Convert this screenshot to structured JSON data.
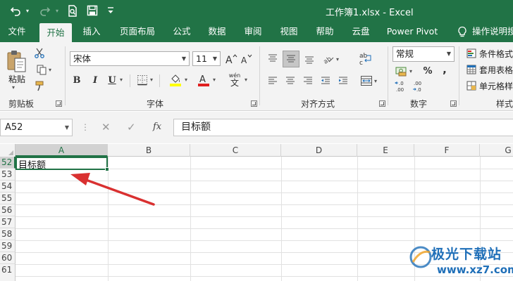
{
  "window": {
    "title": "工作簿1.xlsx  -  Excel"
  },
  "quick_access": [
    "undo-icon",
    "redo-icon",
    "print-preview-icon",
    "save-icon",
    "customize-qat-icon"
  ],
  "tabs": [
    {
      "label": "文件"
    },
    {
      "label": "开始",
      "active": true
    },
    {
      "label": "插入"
    },
    {
      "label": "页面布局"
    },
    {
      "label": "公式"
    },
    {
      "label": "数据"
    },
    {
      "label": "审阅"
    },
    {
      "label": "视图"
    },
    {
      "label": "帮助"
    },
    {
      "label": "云盘"
    },
    {
      "label": "Power Pivot"
    },
    {
      "label": "操作说明搜"
    }
  ],
  "ribbon": {
    "clipboard": {
      "label": "剪贴板",
      "paste_label": "粘贴"
    },
    "font": {
      "label": "字体",
      "font_name": "宋体",
      "font_size": "11",
      "bold": "B",
      "italic": "I",
      "underline": "U",
      "phonetic": "wén"
    },
    "alignment": {
      "label": "对齐方式"
    },
    "number": {
      "label": "数字",
      "format": "常规",
      "percent": "%",
      "comma": ","
    },
    "styles": {
      "label": "样式",
      "conditional_formatting": "条件格式",
      "format_as_table": "套用表格",
      "cell_styles": "单元格样"
    }
  },
  "formula_bar": {
    "name_box": "A52",
    "fx": "fx",
    "formula": "目标额"
  },
  "grid": {
    "columns": [
      "A",
      "B",
      "C",
      "D",
      "E",
      "F",
      "G"
    ],
    "rows": [
      "52",
      "53",
      "54",
      "55",
      "56",
      "57",
      "58",
      "59",
      "60",
      "61"
    ],
    "active_cell": "A52",
    "cells": {
      "A52": "目标额"
    }
  },
  "colors": {
    "excel_green": "#217346",
    "annotation_arrow": "#d93030"
  },
  "watermark": {
    "line1": "极光下载站",
    "line2": "www.xz7.com"
  }
}
